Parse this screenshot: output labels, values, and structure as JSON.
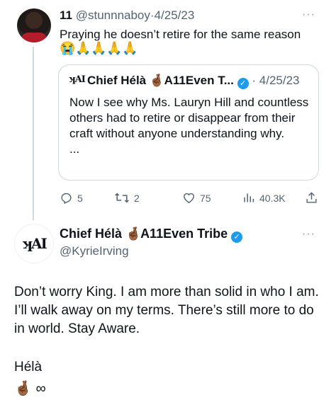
{
  "reply": {
    "display_name": "11",
    "handle": "@stunnnaboy",
    "separator": "·",
    "date": "4/25/23",
    "more": "···",
    "text": "Praying he doesn’t retire for the same reason",
    "emojis": [
      "😭",
      "🙏",
      "🙏",
      "🙏",
      "🙏"
    ]
  },
  "quote": {
    "logo": "ʞAI",
    "name": "Chief Hélà",
    "hand_emoji": "🤞🏾",
    "name_suffix": "A11Even T...",
    "separator": "·",
    "date": "4/25/23",
    "verified_mark": "✓",
    "text": "Now I see why Ms. Lauryn Hill and countless others had to retire or disappear from their craft without anyone understanding why.",
    "ellipsis": "..."
  },
  "actions": {
    "replies": "5",
    "retweets": "2",
    "likes": "75",
    "views": "40.3K"
  },
  "main": {
    "logo": "ʞAI",
    "name": "Chief Hélà",
    "hand_emoji": "🤞🏾",
    "name_suffix": "A11Even Tribe",
    "verified_mark": "✓",
    "handle": "@KyrieIrving",
    "more": "···",
    "body": "Don’t worry King. I am more than solid in who I am. I’ll walk away on my terms. There’s still more to do in world. Stay Aware.",
    "signature": "Hélà",
    "sign_emoji": "🤞🏾",
    "infinity": "∞"
  },
  "colors": {
    "verified": "#1d9bf0",
    "muted": "#536471",
    "border": "#cfd9de"
  },
  "icons": {
    "reply": "reply-icon",
    "retweet": "retweet-icon",
    "like": "heart-icon",
    "views": "views-icon",
    "share": "share-icon"
  }
}
